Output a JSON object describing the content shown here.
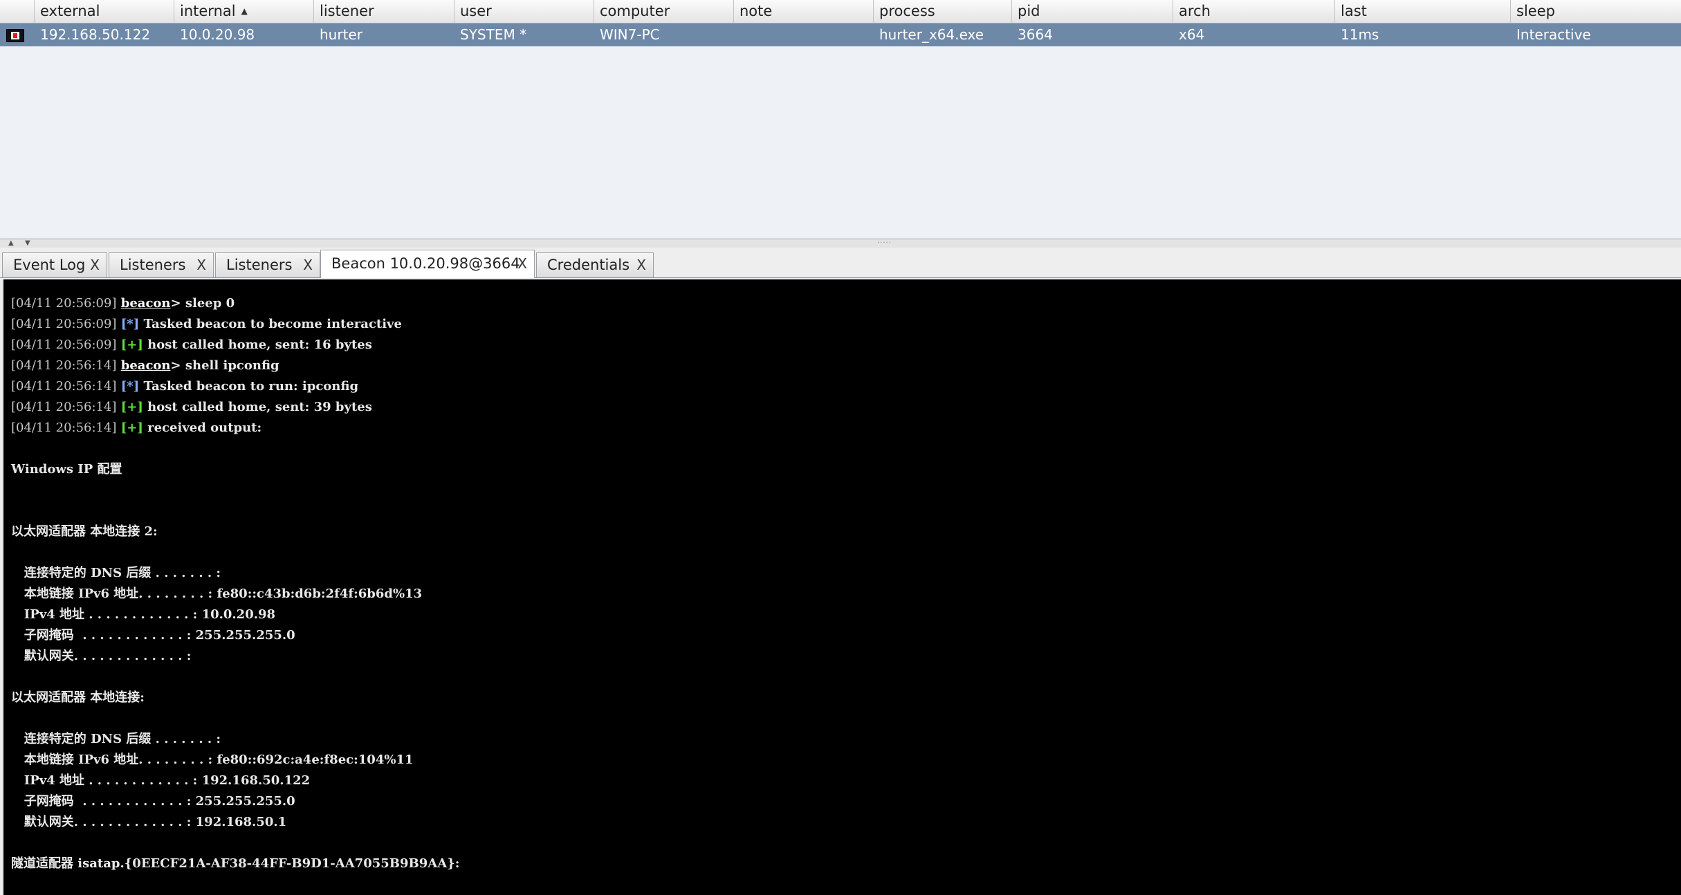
{
  "table": {
    "columns": [
      "",
      "external",
      "internal",
      "listener",
      "user",
      "computer",
      "note",
      "process",
      "pid",
      "arch",
      "last",
      "sleep"
    ],
    "sort_indicator": "▲",
    "row": {
      "icon": "beacon-session-icon",
      "external": "192.168.50.122",
      "internal": "10.0.20.98",
      "listener": "hurter",
      "user": "SYSTEM *",
      "computer": "WIN7-PC",
      "note": "",
      "process": "hurter_x64.exe",
      "pid": "3664",
      "arch": "x64",
      "last": "11ms",
      "sleep": "Interactive"
    },
    "selected_row_color": "#6e88a8"
  },
  "splitter": {
    "up": "▲",
    "down": "▼",
    "grip": "·····"
  },
  "tabs": [
    {
      "label": "Event Log",
      "close": "X",
      "active": false
    },
    {
      "label": "Listeners",
      "close": "X",
      "active": false
    },
    {
      "label": "Listeners",
      "close": "X",
      "active": false
    },
    {
      "label": "Beacon 10.0.20.98@3664",
      "close": "X",
      "active": true
    },
    {
      "label": "Credentials",
      "close": "X",
      "active": false
    }
  ],
  "console": {
    "colors": {
      "background": "#000000",
      "info": "#86aeff",
      "ok": "#5fde3c"
    },
    "lines": [
      {
        "ts": "[04/11 20:56:09]",
        "prompt": "beacon",
        "text": "> sleep 0"
      },
      {
        "ts": "[04/11 20:56:09]",
        "tag": "[*]",
        "tag_type": "info",
        "text": " Tasked beacon to become interactive"
      },
      {
        "ts": "[04/11 20:56:09]",
        "tag": "[+]",
        "tag_type": "ok",
        "text": " host called home, sent: 16 bytes"
      },
      {
        "ts": "[04/11 20:56:14]",
        "prompt": "beacon",
        "text": "> shell ipconfig"
      },
      {
        "ts": "[04/11 20:56:14]",
        "tag": "[*]",
        "tag_type": "info",
        "text": " Tasked beacon to run: ipconfig"
      },
      {
        "ts": "[04/11 20:56:14]",
        "tag": "[+]",
        "tag_type": "ok",
        "text": " host called home, sent: 39 bytes"
      },
      {
        "ts": "[04/11 20:56:14]",
        "tag": "[+]",
        "tag_type": "ok",
        "text": " received output:"
      },
      {
        "text": ""
      },
      {
        "text": "Windows IP 配置"
      },
      {
        "text": ""
      },
      {
        "text": ""
      },
      {
        "text": "以太网适配器 本地连接 2:"
      },
      {
        "text": ""
      },
      {
        "text": "   连接特定的 DNS 后缀 . . . . . . . :"
      },
      {
        "text": "   本地链接 IPv6 地址. . . . . . . . : fe80::c43b:d6b:2f4f:6b6d%13"
      },
      {
        "text": "   IPv4 地址 . . . . . . . . . . . . : 10.0.20.98"
      },
      {
        "text": "   子网掩码  . . . . . . . . . . . . : 255.255.255.0"
      },
      {
        "text": "   默认网关. . . . . . . . . . . . . :"
      },
      {
        "text": ""
      },
      {
        "text": "以太网适配器 本地连接:"
      },
      {
        "text": ""
      },
      {
        "text": "   连接特定的 DNS 后缀 . . . . . . . :"
      },
      {
        "text": "   本地链接 IPv6 地址. . . . . . . . : fe80::692c:a4e:f8ec:104%11"
      },
      {
        "text": "   IPv4 地址 . . . . . . . . . . . . : 192.168.50.122"
      },
      {
        "text": "   子网掩码  . . . . . . . . . . . . : 255.255.255.0"
      },
      {
        "text": "   默认网关. . . . . . . . . . . . . : 192.168.50.1"
      },
      {
        "text": ""
      },
      {
        "text": "隧道适配器 isatap.{0EECF21A-AF38-44FF-B9D1-AA7055B9B9AA}:"
      }
    ]
  }
}
